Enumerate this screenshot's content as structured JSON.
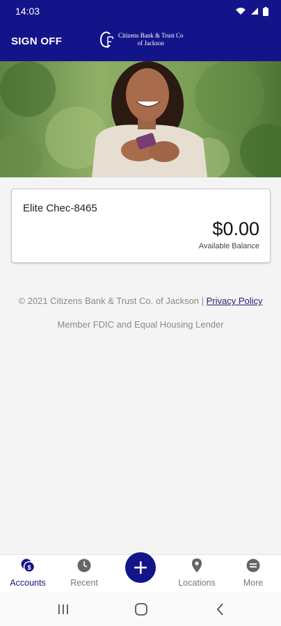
{
  "status_bar": {
    "time": "14:03",
    "icons": [
      "wifi-icon",
      "signal-icon",
      "battery-icon"
    ]
  },
  "header": {
    "sign_off_label": "SIGN OFF",
    "brand_mark": "CB",
    "brand_line1": "Citizens Bank & Trust Co",
    "brand_line2": "of Jackson"
  },
  "account": {
    "name": "Elite Chec-8465",
    "balance": "$0.00",
    "balance_label": "Available Balance"
  },
  "footer": {
    "copyright": "© 2021 Citizens Bank & Trust Co. of Jackson |",
    "privacy_label": "Privacy Policy",
    "fdic": "Member FDIC and Equal Housing Lender"
  },
  "nav": {
    "items": [
      {
        "label": "Accounts",
        "icon": "accounts-dollar-icon",
        "active": true
      },
      {
        "label": "Recent",
        "icon": "clock-icon",
        "active": false
      },
      {
        "label": "",
        "icon": "plus-icon",
        "active": false
      },
      {
        "label": "Locations",
        "icon": "location-pin-icon",
        "active": false
      },
      {
        "label": "More",
        "icon": "more-menu-icon",
        "active": false
      }
    ]
  },
  "system_nav": {
    "icons": [
      "recents-icon",
      "home-icon",
      "back-icon"
    ]
  },
  "colors": {
    "brand": "#14148a",
    "background": "#f4f4f4",
    "muted_text": "#8a8a8a",
    "active_nav": "#14148a"
  }
}
